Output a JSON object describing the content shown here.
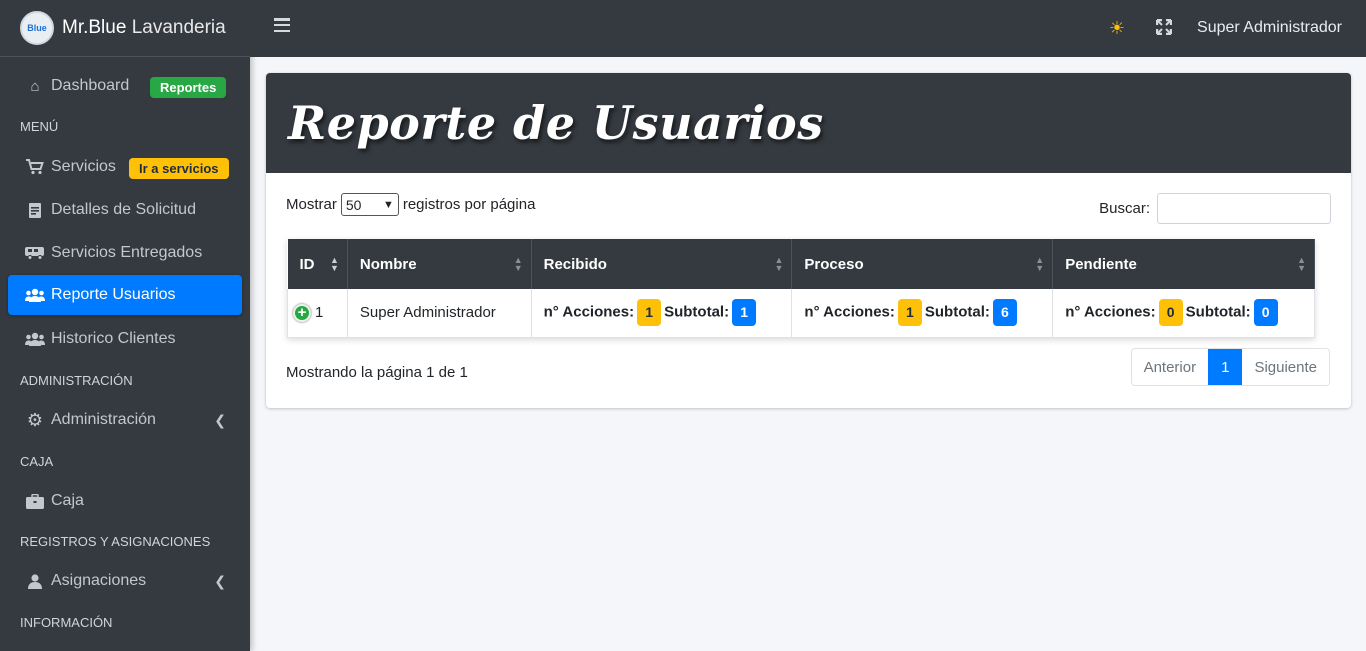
{
  "brand": {
    "logo_text": "Blue",
    "name_bold": "Mr.Blue",
    "name_light": "Lavanderia"
  },
  "topbar": {
    "user": "Super Administrador"
  },
  "sidebar": {
    "dashboard": "Dashboard",
    "dashboard_badge": "Reportes",
    "header_menu": "MENÚ",
    "servicios": "Servicios",
    "servicios_badge": "Ir a servicios",
    "detalles": "Detalles de Solicitud",
    "entregados": "Servicios Entregados",
    "reporte_usuarios": "Reporte Usuarios",
    "historico": "Historico Clientes",
    "header_admin": "ADMINISTRACIÓN",
    "administracion": "Administración",
    "header_caja": "CAJA",
    "caja": "Caja",
    "header_registros": "REGISTROS Y ASIGNACIONES",
    "asignaciones": "Asignaciones",
    "header_info": "INFORMACIÓN"
  },
  "main": {
    "title": "Reporte de Usuarios",
    "length_prefix": "Mostrar",
    "length_value": "50",
    "length_suffix": "registros por página",
    "search_label": "Buscar:",
    "columns": [
      "ID",
      "Nombre",
      "Recibido",
      "Proceso",
      "Pendiente"
    ],
    "row": {
      "id": "1",
      "nombre": "Super Administrador",
      "acciones_label": "n° Acciones:",
      "subtotal_label": "Subtotal:",
      "recibido": {
        "acciones": "1",
        "subtotal": "1"
      },
      "proceso": {
        "acciones": "1",
        "subtotal": "6"
      },
      "pendiente": {
        "acciones": "0",
        "subtotal": "0"
      }
    },
    "info": "Mostrando la página 1 de 1",
    "pager": {
      "prev": "Anterior",
      "current": "1",
      "next": "Siguiente"
    }
  },
  "colors": {
    "primary": "#007bff",
    "success": "#28a745",
    "warning": "#ffc107",
    "dark": "#343a40"
  }
}
